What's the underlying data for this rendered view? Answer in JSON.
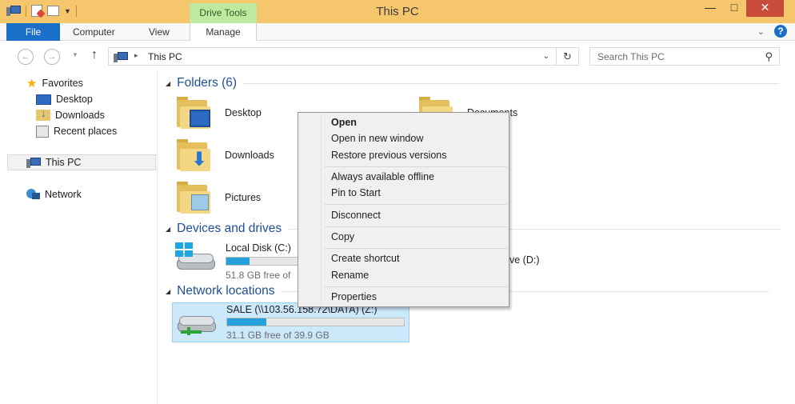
{
  "window": {
    "title": "This PC",
    "contextual_tab_group": "Drive Tools",
    "minimize": "—",
    "maximize": "□",
    "close": "✕"
  },
  "ribbon": {
    "tabs": [
      "File",
      "Computer",
      "View",
      "Manage"
    ],
    "collapse_icon": "chevron-down-icon",
    "help_label": "?"
  },
  "address": {
    "back_icon": "←",
    "forward_icon": "→",
    "up_icon": "↑",
    "separator": "▸",
    "path": "This PC",
    "refresh_icon": "↻"
  },
  "search": {
    "placeholder": "Search This PC"
  },
  "nav": {
    "favorites": "Favorites",
    "desktop": "Desktop",
    "downloads": "Downloads",
    "recent": "Recent places",
    "this_pc": "This PC",
    "network": "Network"
  },
  "groups": {
    "folders": "Folders (6)",
    "devices": "Devices and drives",
    "network_locations": "Network locations"
  },
  "folders": {
    "desktop": "Desktop",
    "documents": "Documents",
    "downloads": "Downloads",
    "pictures": "Pictures"
  },
  "drives": [
    {
      "name": "Local Disk (C:)",
      "free": "51.8 GB free of",
      "used_fraction": 0.13
    },
    {
      "name": "ve (D:)"
    },
    {
      "name": "SALE (\\\\103.56.158.72\\DATA) (Z:)",
      "free": "31.1 GB free of 39.9 GB",
      "used_fraction": 0.22
    }
  ],
  "context_menu": {
    "open": "Open",
    "open_new_window": "Open in new window",
    "restore": "Restore previous versions",
    "offline": "Always available offline",
    "pin": "Pin to Start",
    "disconnect": "Disconnect",
    "copy": "Copy",
    "create_shortcut": "Create shortcut",
    "rename": "Rename",
    "properties": "Properties"
  },
  "colors": {
    "titlebar": "#f6c66d",
    "file_tab": "#1a6fc9",
    "close_button": "#c94c3b",
    "group_header": "#1f4f95",
    "drive_bar": "#26a0da",
    "selection": "#cce8fb"
  }
}
